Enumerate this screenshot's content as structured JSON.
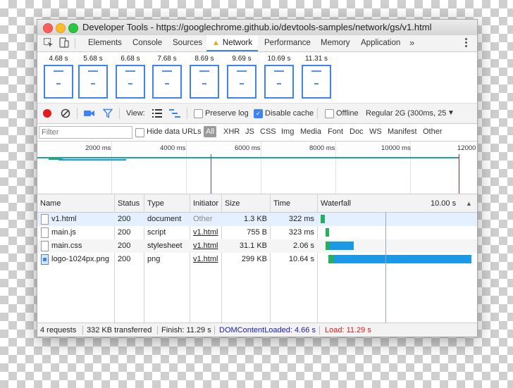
{
  "window": {
    "title": "Developer Tools - https://googlechrome.github.io/devtools-samples/network/gs/v1.html"
  },
  "tabs": [
    "Elements",
    "Console",
    "Sources",
    "Network",
    "Performance",
    "Memory",
    "Application"
  ],
  "active_tab": "Network",
  "tabs_overflow": "»",
  "filmstrip": [
    "4.68 s",
    "5.68 s",
    "6.68 s",
    "7.68 s",
    "8.69 s",
    "9.69 s",
    "10.69 s",
    "11.31 s"
  ],
  "toolbar": {
    "view_label": "View:",
    "preserve_log": {
      "label": "Preserve log",
      "checked": false
    },
    "disable_cache": {
      "label": "Disable cache",
      "checked": true
    },
    "offline": {
      "label": "Offline",
      "checked": false
    },
    "throttle": "Regular 2G (300ms, 25",
    "throttle_caret": "▼"
  },
  "filter": {
    "placeholder": "Filter",
    "hide_data_urls": "Hide data URLs",
    "types": [
      "All",
      "XHR",
      "JS",
      "CSS",
      "Img",
      "Media",
      "Font",
      "Doc",
      "WS",
      "Manifest",
      "Other"
    ]
  },
  "overview": {
    "ticks": [
      "2000 ms",
      "4000 ms",
      "6000 ms",
      "8000 ms",
      "10000 ms",
      "12000"
    ]
  },
  "table": {
    "headers": [
      "Name",
      "Status",
      "Type",
      "Initiator",
      "Size",
      "Time",
      "Waterfall"
    ],
    "waterfall_scale": "10.00 s",
    "sort_icon": "▲",
    "rows": [
      {
        "name": "v1.html",
        "status": "200",
        "type": "document",
        "initiator": "Other",
        "size": "1.3 KB",
        "time": "322 ms",
        "file": "doc",
        "start_s": 0.0,
        "wait_s": 0.3,
        "dl_s": 0.0
      },
      {
        "name": "main.js",
        "status": "200",
        "type": "script",
        "initiator": "v1.html",
        "size": "755 B",
        "time": "323 ms",
        "file": "doc",
        "start_s": 0.35,
        "wait_s": 0.3,
        "dl_s": 0.0
      },
      {
        "name": "main.css",
        "status": "200",
        "type": "stylesheet",
        "initiator": "v1.html",
        "size": "31.1 KB",
        "time": "2.06 s",
        "file": "doc",
        "start_s": 0.35,
        "wait_s": 0.35,
        "dl_s": 1.75
      },
      {
        "name": "logo-1024px.png",
        "status": "200",
        "type": "png",
        "initiator": "v1.html",
        "size": "299 KB",
        "time": "10.64 s",
        "file": "img",
        "start_s": 0.6,
        "wait_s": 0.4,
        "dl_s": 10.25
      }
    ]
  },
  "status": {
    "requests": "4 requests",
    "transferred": "332 KB transferred",
    "finish": "Finish: 11.29 s",
    "domcontentloaded": "DOMContentLoaded: 4.66 s",
    "load": "Load: 11.29 s"
  },
  "colors": {
    "accent": "#3e82f7",
    "waiting": "#27ae60",
    "receiving": "#1a9ae6",
    "dcl": "#1a1ab8",
    "load": "#e5181a"
  }
}
